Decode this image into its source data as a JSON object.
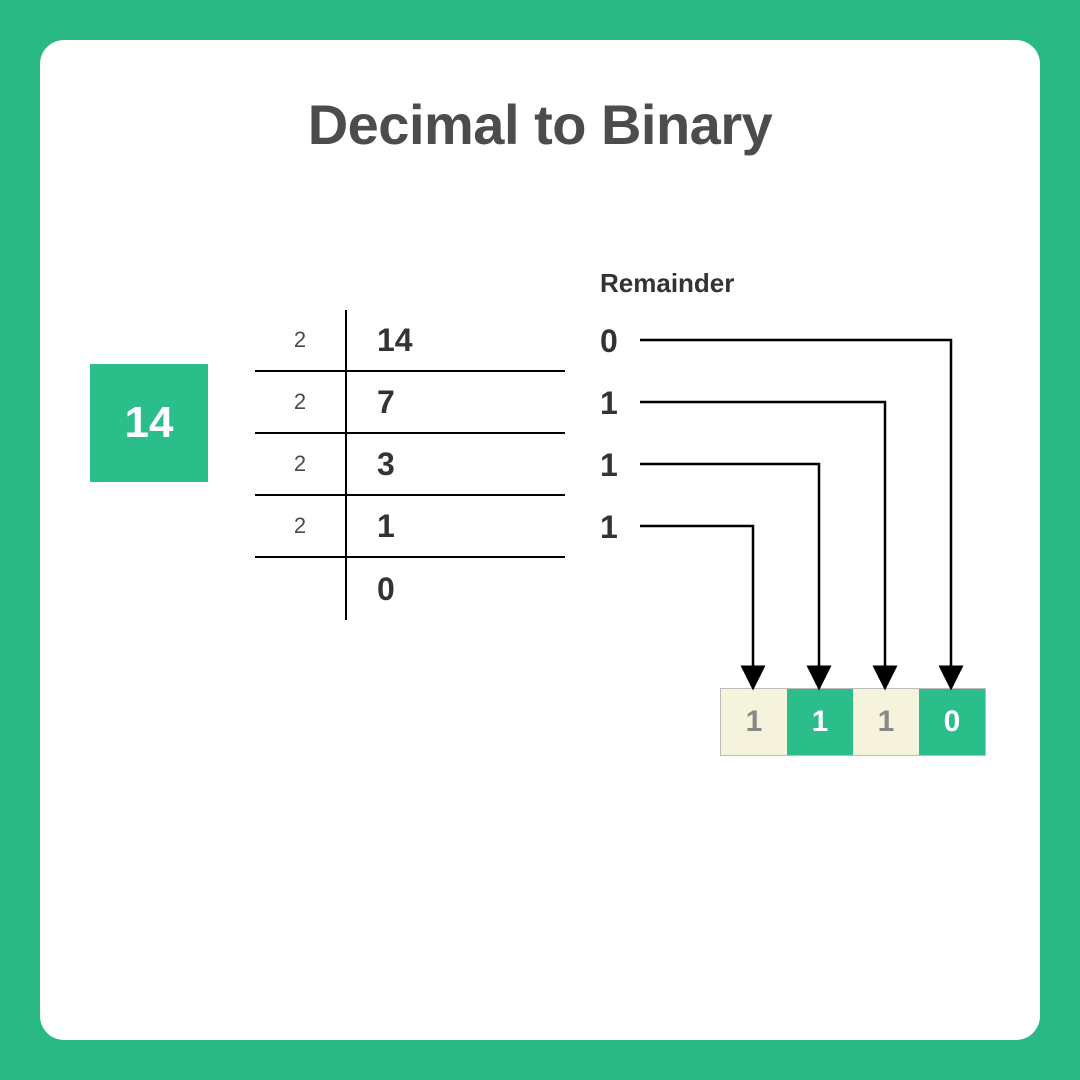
{
  "title": "Decimal to Binary",
  "decimal_value": "14",
  "remainder_label": "Remainder",
  "division": {
    "steps": [
      {
        "divisor": "2",
        "quotient": "14",
        "remainder": "0"
      },
      {
        "divisor": "2",
        "quotient": "7",
        "remainder": "1"
      },
      {
        "divisor": "2",
        "quotient": "3",
        "remainder": "1"
      },
      {
        "divisor": "2",
        "quotient": "1",
        "remainder": "1"
      }
    ],
    "final": "0"
  },
  "result_bits": [
    {
      "value": "1",
      "style": "cream"
    },
    {
      "value": "1",
      "style": "green"
    },
    {
      "value": "1",
      "style": "cream"
    },
    {
      "value": "0",
      "style": "green"
    }
  ],
  "colors": {
    "accent": "#2ab885",
    "bit_green": "#2bbd8a",
    "bit_cream": "#f6f3dc"
  }
}
